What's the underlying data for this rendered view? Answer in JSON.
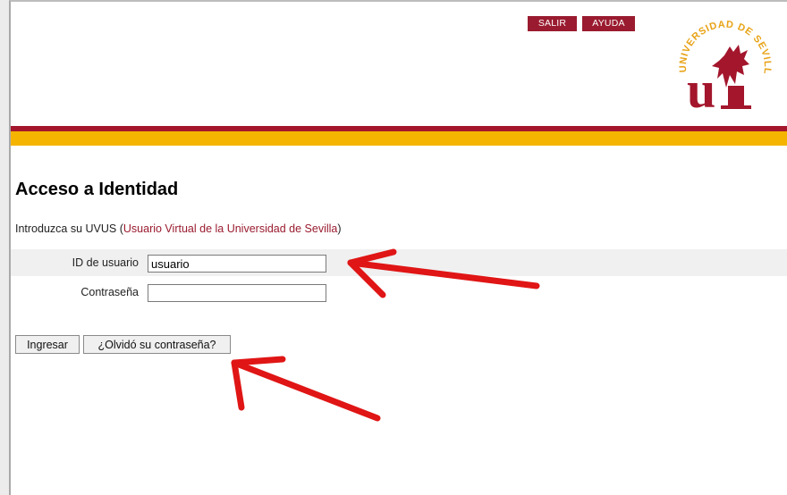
{
  "header": {
    "buttons": {
      "salir": "SALIR",
      "ayuda": "AYUDA"
    },
    "logo": {
      "arc_text": "UNIVERSIDAD DE SEVILLA",
      "glyph": "u"
    }
  },
  "main": {
    "title": "Acceso a Identidad",
    "intro": {
      "prefix": "Introduzca su UVUS (",
      "link": "Usuario Virtual de la Universidad de Sevilla",
      "suffix": ")"
    },
    "form": {
      "user_label": "ID de usuario",
      "user_value": "usuario",
      "password_label": "Contraseña",
      "password_value": ""
    },
    "buttons": {
      "submit": "Ingresar",
      "forgot": "¿Olvidó su contraseña?"
    }
  },
  "annotations": [
    {
      "shape": "red-arrow",
      "points_to": "user-id-input"
    },
    {
      "shape": "red-arrow",
      "points_to": "forgot-password-button"
    }
  ],
  "colors": {
    "brand_red": "#a3162c",
    "brand_yellow": "#f5b400",
    "button_red": "#9a1b2f",
    "annotation_red": "#e01515"
  }
}
